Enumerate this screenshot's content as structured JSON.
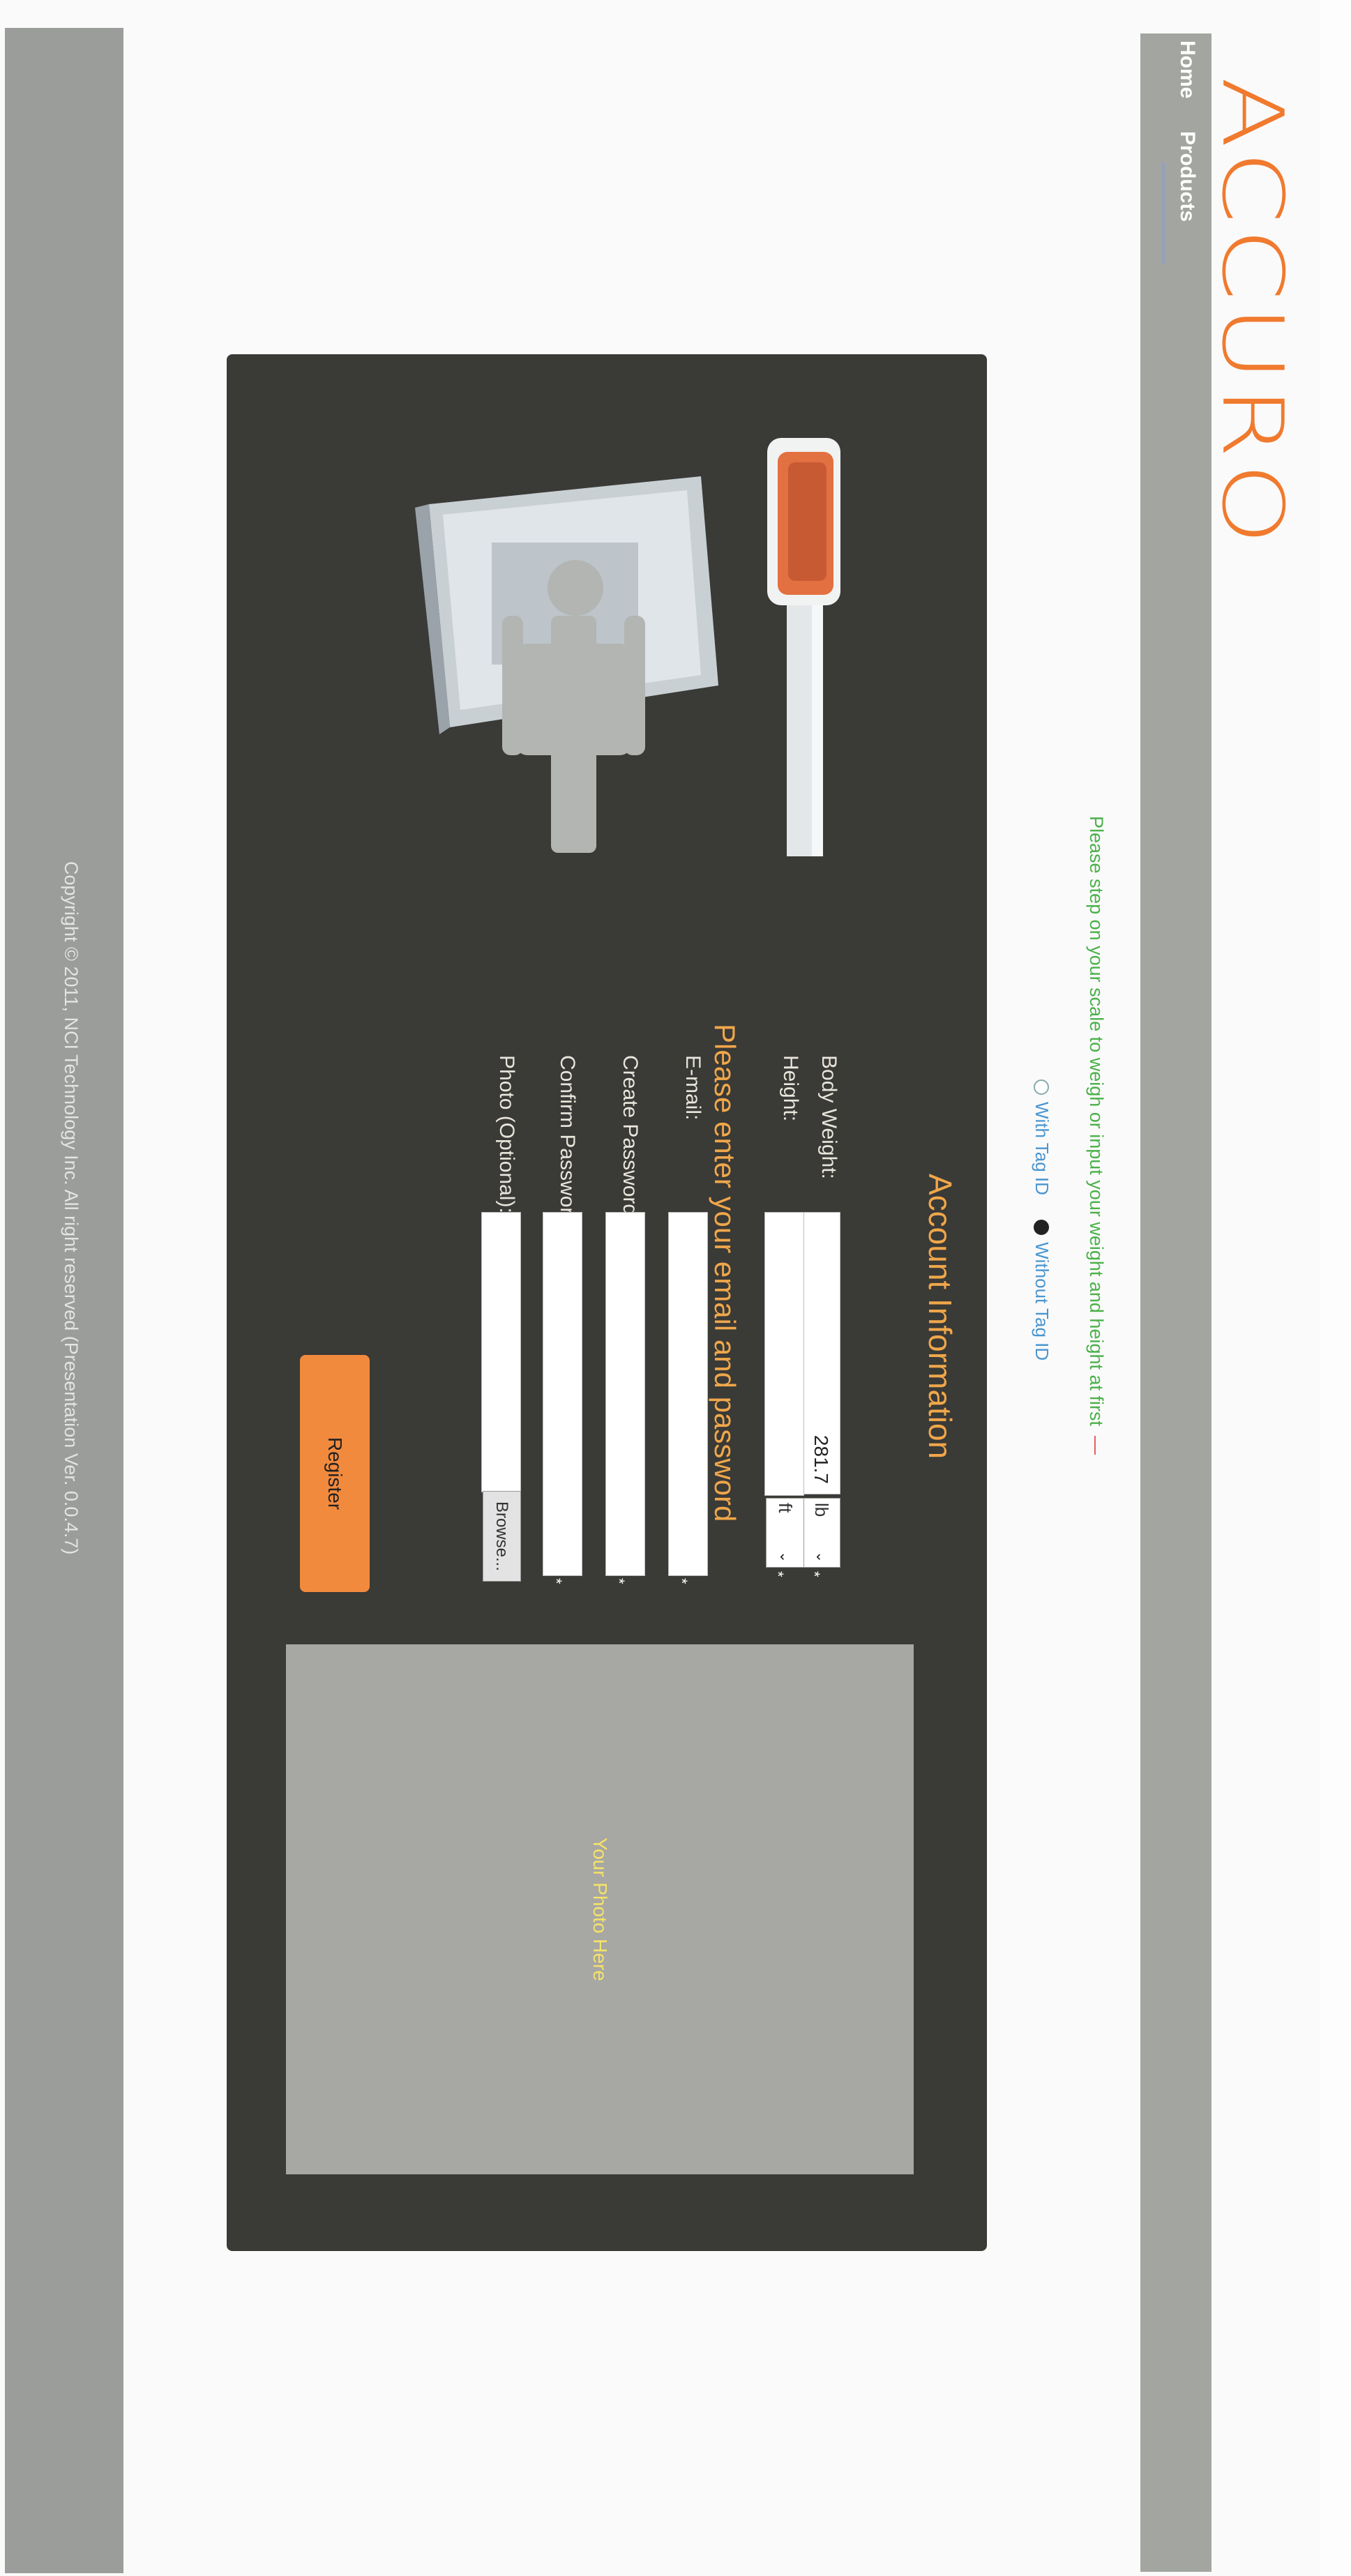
{
  "brand": {
    "logo_text": "ACCURO",
    "accent_color": "#f07a2e"
  },
  "nav": {
    "items": [
      "Home",
      "Products"
    ]
  },
  "instruction": {
    "text": "Please step on your scale to weigh or input your weight and height at first",
    "suffix": "—"
  },
  "tag_options": {
    "with": {
      "label": "With Tag ID",
      "selected": false
    },
    "without": {
      "label": "Without Tag ID",
      "selected": true
    }
  },
  "form": {
    "title": "Account Information",
    "body_weight": {
      "label": "Body Weight:",
      "value": "281.7",
      "unit": "lb"
    },
    "height": {
      "label": "Height:",
      "value": "",
      "unit": "ft"
    },
    "email_section_title": "Please enter your email and password",
    "email": {
      "label": "E-mail:"
    },
    "create_password": {
      "label": "Create Password:"
    },
    "confirm_password": {
      "label": "Confirm Password:"
    },
    "photo": {
      "label": "Photo (Optional):",
      "browse_label": "Browse..."
    },
    "register_label": "Register",
    "required_mark": "*"
  },
  "photo_placeholder": {
    "text": "Your Photo Here"
  },
  "footer": {
    "copyright": "Copyright © 2011, NCI Technology Inc. All right reserved (Presentation Ver. 0.0.4.7)"
  },
  "colors": {
    "panel_bg": "#3a3a37",
    "accent_orange": "#f0a74a",
    "nav_bg": "#a3a6a0",
    "footer_bg": "#9a9d99",
    "instruction_green": "#4bb04a"
  }
}
